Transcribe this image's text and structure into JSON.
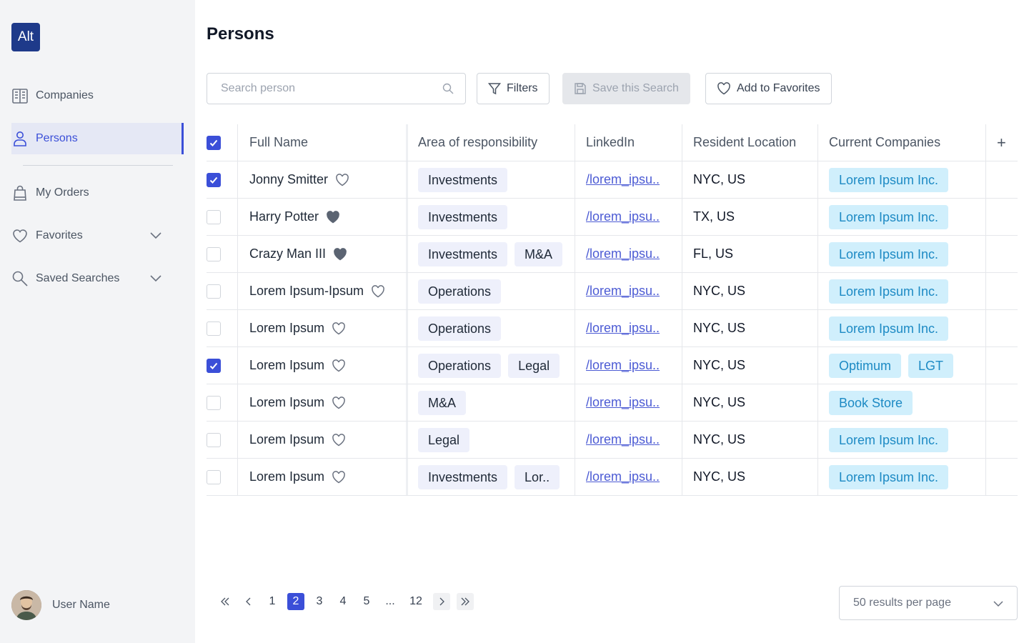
{
  "app": {
    "logo_text": "Alt",
    "accent": "#3b4fd8"
  },
  "sidebar": {
    "items": [
      {
        "label": "Companies",
        "icon": "building-icon"
      },
      {
        "label": "Persons",
        "icon": "person-icon",
        "active": true
      },
      {
        "label": "My Orders",
        "icon": "bag-icon"
      },
      {
        "label": "Favorites",
        "icon": "heart-icon",
        "expandable": true
      },
      {
        "label": "Saved Searches",
        "icon": "search-icon",
        "expandable": true
      }
    ],
    "user": {
      "name": "User Name"
    }
  },
  "page": {
    "title": "Persons"
  },
  "toolbar": {
    "search_placeholder": "Search person",
    "filters_label": "Filters",
    "save_search_label": "Save this Search",
    "add_favorites_label": "Add to Favorites"
  },
  "table": {
    "columns": [
      "Full Name",
      "Area of responsibility",
      "LinkedIn",
      "Resident Location",
      "Current Companies"
    ],
    "add_column": "+",
    "header_checked": true,
    "rows": [
      {
        "checked": true,
        "name": "Jonny Smitter",
        "favorite": false,
        "areas": [
          "Investments"
        ],
        "linkedin": "/lorem_ipsu..",
        "location": "NYC, US",
        "companies": [
          "Lorem Ipsum Inc."
        ]
      },
      {
        "checked": false,
        "name": "Harry Potter",
        "favorite": true,
        "areas": [
          "Investments"
        ],
        "linkedin": "/lorem_ipsu..",
        "location": "TX, US",
        "companies": [
          "Lorem Ipsum Inc."
        ]
      },
      {
        "checked": false,
        "name": "Crazy Man III",
        "favorite": true,
        "areas": [
          "Investments",
          "M&A"
        ],
        "linkedin": "/lorem_ipsu..",
        "location": "FL, US",
        "companies": [
          "Lorem Ipsum Inc."
        ]
      },
      {
        "checked": false,
        "name": "Lorem Ipsum-Ipsum",
        "favorite": false,
        "areas": [
          "Operations"
        ],
        "linkedin": "/lorem_ipsu..",
        "location": "NYC, US",
        "companies": [
          "Lorem Ipsum Inc."
        ]
      },
      {
        "checked": false,
        "name": "Lorem Ipsum",
        "favorite": false,
        "areas": [
          "Operations"
        ],
        "linkedin": "/lorem_ipsu..",
        "location": "NYC, US",
        "companies": [
          "Lorem Ipsum Inc."
        ]
      },
      {
        "checked": true,
        "name": "Lorem Ipsum",
        "favorite": false,
        "areas": [
          "Operations",
          "Legal"
        ],
        "linkedin": "/lorem_ipsu..",
        "location": "NYC, US",
        "companies": [
          "Optimum",
          "LGT"
        ]
      },
      {
        "checked": false,
        "name": "Lorem Ipsum",
        "favorite": false,
        "areas": [
          "M&A"
        ],
        "linkedin": "/lorem_ipsu..",
        "location": "NYC, US",
        "companies": [
          "Book Store"
        ]
      },
      {
        "checked": false,
        "name": "Lorem Ipsum",
        "favorite": false,
        "areas": [
          "Legal"
        ],
        "linkedin": "/lorem_ipsu..",
        "location": "NYC, US",
        "companies": [
          "Lorem Ipsum Inc."
        ]
      },
      {
        "checked": false,
        "name": "Lorem Ipsum",
        "favorite": false,
        "areas": [
          "Investments",
          "Lor.."
        ],
        "linkedin": "/lorem_ipsu..",
        "location": "NYC, US",
        "companies": [
          "Lorem Ipsum Inc."
        ]
      }
    ]
  },
  "pagination": {
    "pages": [
      "1",
      "2",
      "3",
      "4",
      "5",
      "...",
      "12"
    ],
    "current": "2",
    "per_page": "50 results per page"
  }
}
